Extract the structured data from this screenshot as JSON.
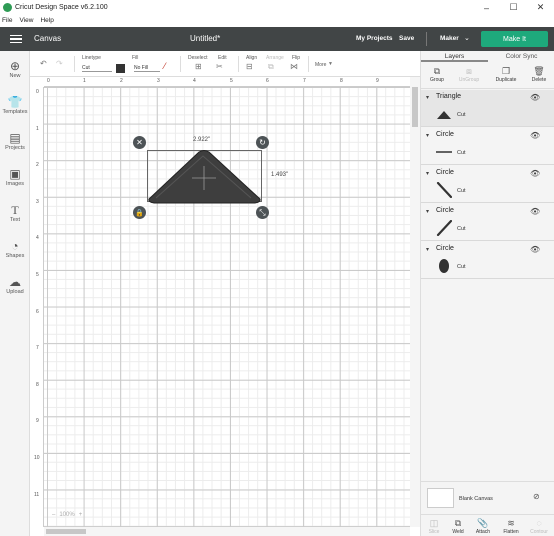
{
  "window": {
    "title": "Cricut Design Space  v6.2.100",
    "minimize": "–",
    "maximize": "☐",
    "close": "✕"
  },
  "menu": [
    "File",
    "View",
    "Help"
  ],
  "header": {
    "canvas": "Canvas",
    "doc_title": "Untitled*",
    "my_projects": "My Projects",
    "save": "Save",
    "machine": "Maker",
    "make_it": "Make It",
    "accent": "#1ea97c"
  },
  "sidebar": [
    {
      "label": "New",
      "icon": "plus-circle-icon"
    },
    {
      "label": "Templates",
      "icon": "shirt-icon"
    },
    {
      "label": "Projects",
      "icon": "projects-icon"
    },
    {
      "label": "Images",
      "icon": "image-icon"
    },
    {
      "label": "Text",
      "icon": "text-icon"
    },
    {
      "label": "Shapes",
      "icon": "shapes-icon"
    },
    {
      "label": "Upload",
      "icon": "upload-icon"
    }
  ],
  "toolbar": {
    "linetype_label": "Linetype",
    "linetype_value": "Cut",
    "fill_label": "Fill",
    "fill_value": "No Fill",
    "deselect": "Deselect",
    "edit": "Edit",
    "align": "Align",
    "arrange": "Arrange",
    "flip": "Flip",
    "more": "More"
  },
  "ruler": {
    "top": [
      "0",
      "1",
      "2",
      "3",
      "4",
      "5",
      "6",
      "7",
      "8",
      "9"
    ],
    "left": [
      "0",
      "1",
      "2",
      "3",
      "4",
      "5",
      "6",
      "7",
      "8",
      "9",
      "10",
      "11"
    ]
  },
  "selection": {
    "width": "2.922\"",
    "height": "1.493\""
  },
  "zoom": {
    "minus": "–",
    "value": "100%",
    "plus": "+"
  },
  "panel": {
    "tabs": [
      "Layers",
      "Color Sync"
    ],
    "actions": [
      {
        "label": "Group",
        "enabled": true
      },
      {
        "label": "UnGroup",
        "enabled": false
      },
      {
        "label": "Duplicate",
        "enabled": true
      },
      {
        "label": "Delete",
        "enabled": true
      }
    ],
    "layers": [
      {
        "name": "Triangle",
        "op": "Cut",
        "thumb": "triangle"
      },
      {
        "name": "Circle",
        "op": "Cut",
        "thumb": "line-flat"
      },
      {
        "name": "Circle",
        "op": "Cut",
        "thumb": "line-diag"
      },
      {
        "name": "Circle",
        "op": "Cut",
        "thumb": "line-diag2"
      },
      {
        "name": "Circle",
        "op": "Cut",
        "thumb": "oval"
      }
    ],
    "blank_canvas": "Blank Canvas",
    "bottom_actions": [
      {
        "label": "Slice",
        "enabled": false
      },
      {
        "label": "Weld",
        "enabled": true
      },
      {
        "label": "Attach",
        "enabled": true
      },
      {
        "label": "Flatten",
        "enabled": true
      },
      {
        "label": "Contour",
        "enabled": false
      }
    ]
  }
}
